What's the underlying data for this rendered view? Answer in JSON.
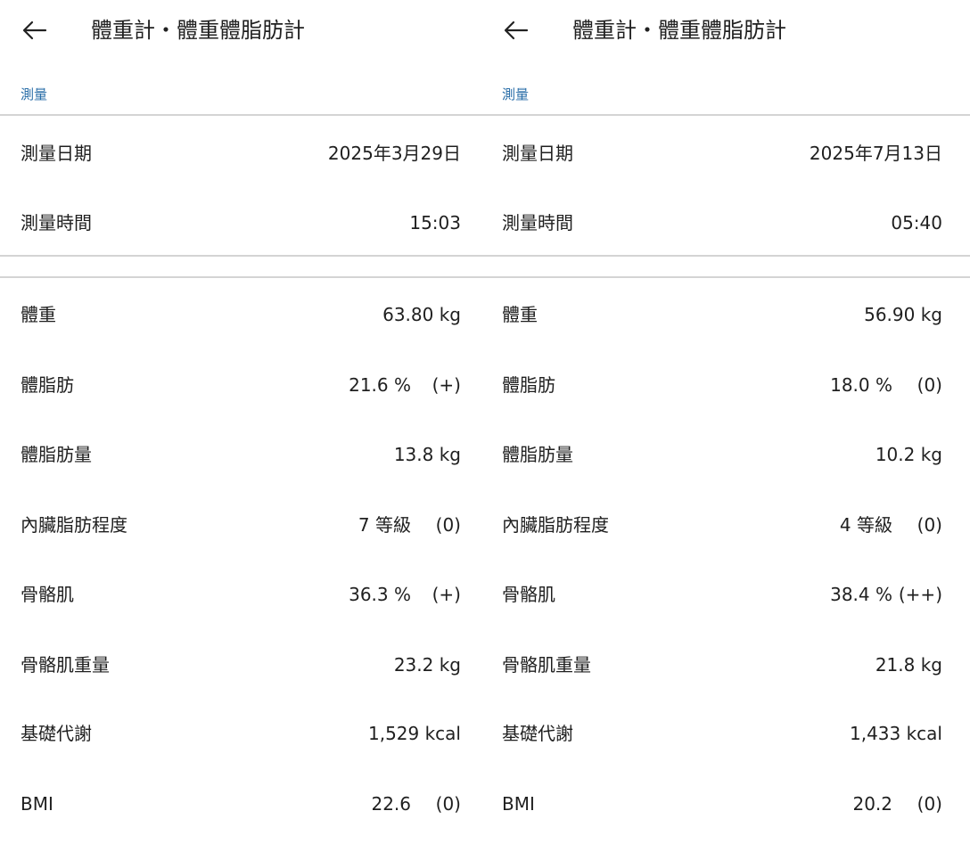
{
  "panels": [
    {
      "header": {
        "title": "體重計・體重體脂肪計",
        "back_icon": "arrow-left-icon"
      },
      "section_label": "測量",
      "measurement": [
        {
          "label": "測量日期",
          "value": "2025年3月29日"
        },
        {
          "label": "測量時間",
          "value": "15:03"
        }
      ],
      "metrics": [
        {
          "label": "體重",
          "value": "63.80 kg",
          "badge": ""
        },
        {
          "label": "體脂肪",
          "value": "21.6 %",
          "badge": "(+)"
        },
        {
          "label": "體脂肪量",
          "value": "13.8 kg",
          "badge": ""
        },
        {
          "label": "內臟脂肪程度",
          "value": "7 等級",
          "badge": "(0)"
        },
        {
          "label": "骨骼肌",
          "value": "36.3 %",
          "badge": "(+)"
        },
        {
          "label": "骨骼肌重量",
          "value": "23.2 kg",
          "badge": ""
        },
        {
          "label": "基礎代謝",
          "value": "1,529 kcal",
          "badge": ""
        },
        {
          "label": "BMI",
          "value": "22.6",
          "badge": "(0)"
        }
      ]
    },
    {
      "header": {
        "title": "體重計・體重體脂肪計",
        "back_icon": "arrow-left-icon"
      },
      "section_label": "測量",
      "measurement": [
        {
          "label": "測量日期",
          "value": "2025年7月13日"
        },
        {
          "label": "測量時間",
          "value": "05:40"
        }
      ],
      "metrics": [
        {
          "label": "體重",
          "value": "56.90 kg",
          "badge": ""
        },
        {
          "label": "體脂肪",
          "value": "18.0 %",
          "badge": "(0)"
        },
        {
          "label": "體脂肪量",
          "value": "10.2 kg",
          "badge": ""
        },
        {
          "label": "內臟脂肪程度",
          "value": "4 等級",
          "badge": "(0)"
        },
        {
          "label": "骨骼肌",
          "value": "38.4 %",
          "badge": "(++)"
        },
        {
          "label": "骨骼肌重量",
          "value": "21.8 kg",
          "badge": ""
        },
        {
          "label": "基礎代謝",
          "value": "1,433 kcal",
          "badge": ""
        },
        {
          "label": "BMI",
          "value": "20.2",
          "badge": "(0)"
        }
      ]
    }
  ],
  "colors": {
    "section_label": "#2a6ea8",
    "divider": "#d4d4d4",
    "text": "#1f1f1f"
  }
}
